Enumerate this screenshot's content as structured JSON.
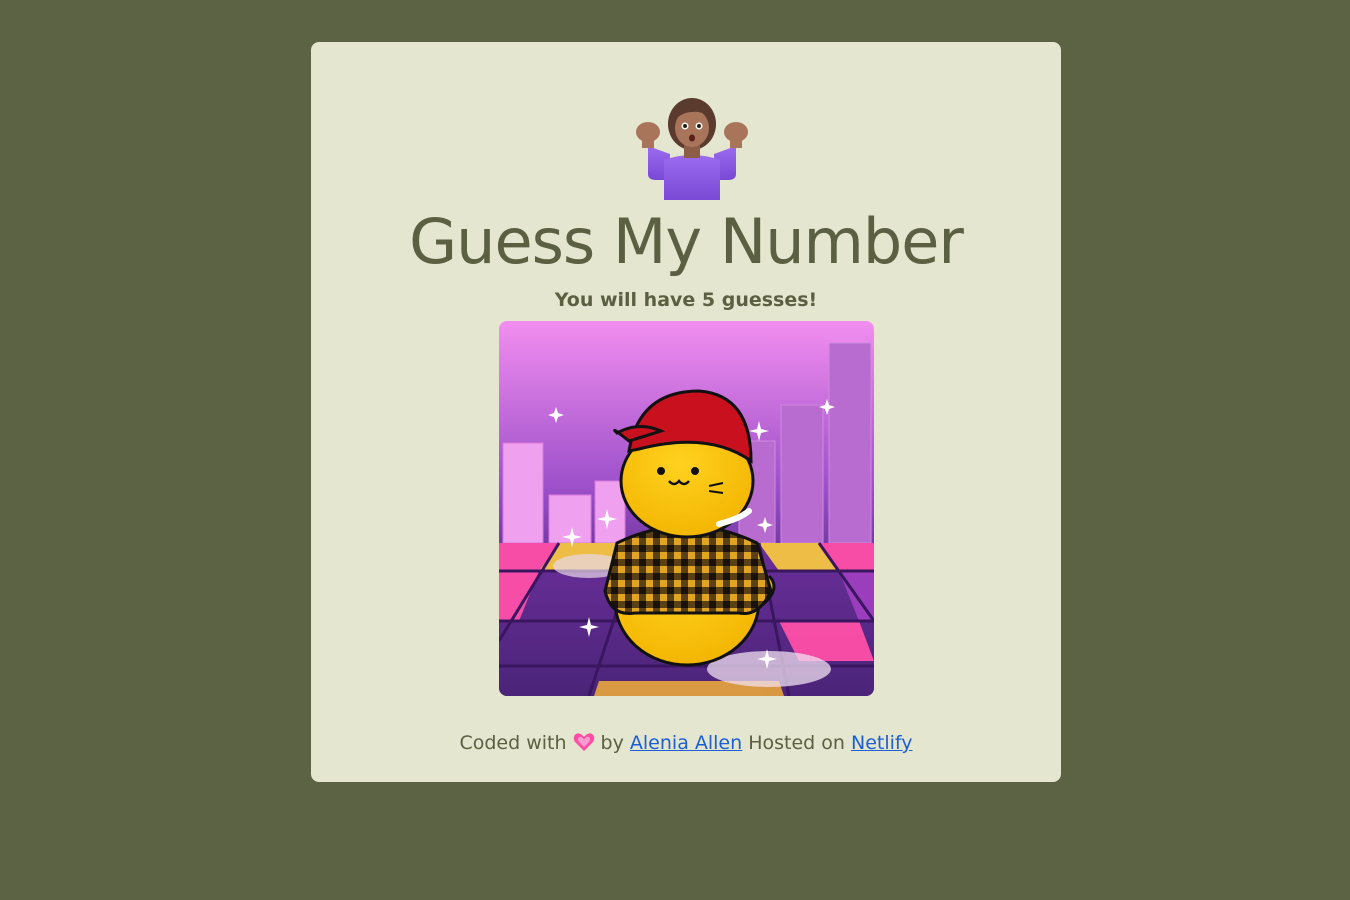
{
  "page": {
    "title": "Guess My Number",
    "subtitle": "You will have 5 guesses!"
  },
  "footer": {
    "coded_with": "Coded with",
    "by": "by",
    "author_name": "Alenia Allen",
    "hosted_on": "Hosted on",
    "host_name": "Netlify"
  },
  "icons": {
    "header": "person-shrugging-icon",
    "footer": "sparkling-heart-icon"
  },
  "colors": {
    "background": "#5c6344",
    "card": "#e5e6cf",
    "text": "#5a6041",
    "link": "#1a5fd6"
  }
}
